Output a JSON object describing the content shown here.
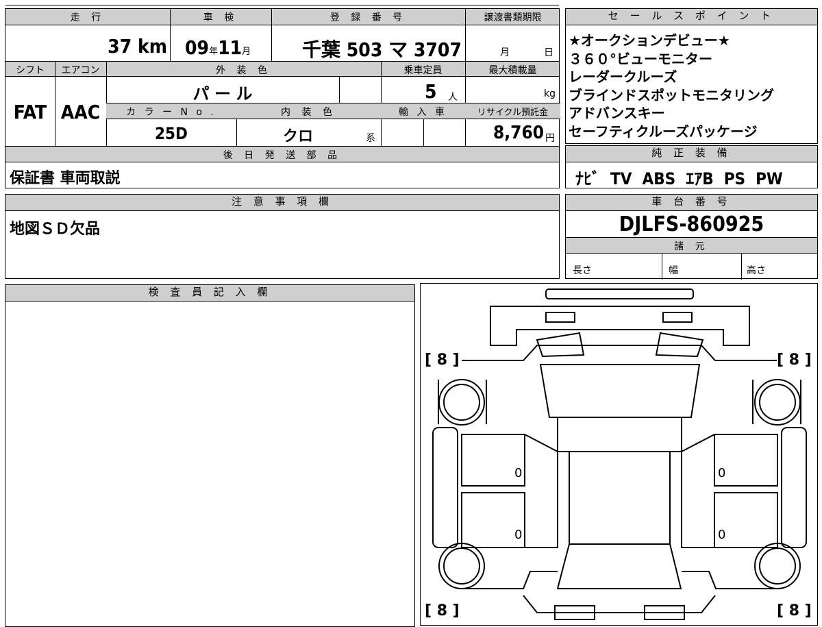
{
  "top": {
    "headers": {
      "mileage": "走 行",
      "inspection": "車 検",
      "registration": "登 録 番 号",
      "transfer_deadline": "譲渡書類期限"
    },
    "mileage_value": "37",
    "mileage_unit": "km",
    "inspection_year": "09",
    "inspection_year_unit": "年",
    "inspection_month": "11",
    "inspection_month_unit": "月",
    "registration_region": "千葉",
    "registration_number": "503 マ 3707",
    "transfer_month": "月",
    "transfer_day": "日"
  },
  "row2": {
    "headers": {
      "shift": "シフト",
      "aircon": "エアコン",
      "exterior_color": "外 装 色",
      "capacity": "乗車定員",
      "max_load": "最大積載量",
      "color_no": "カ ラ ー N o .",
      "interior_color": "内 装 色",
      "import": "輸 入 車",
      "recycle_fee": "リサイクル預託金"
    },
    "shift": "FAT",
    "aircon": "AAC",
    "exterior_color": "パ ー ル",
    "capacity": "5",
    "capacity_unit": "人",
    "max_load_unit": "kg",
    "color_no": "25D",
    "interior_color": "クロ",
    "interior_suffix": "系",
    "recycle_fee": "8,760",
    "recycle_unit": "円"
  },
  "later_parts": {
    "header": "後 日 発 送 部 品",
    "value": "保証書 車両取説"
  },
  "notes": {
    "header": "注 意 事 項 欄",
    "value": "地図ＳＤ欠品"
  },
  "sales_points": {
    "header": "セ ー ル ス ポ イ ン ト",
    "items": [
      "★オークションデビュー★",
      "３６０°ビューモニター",
      "レーダークルーズ",
      "ブラインドスポットモニタリング",
      "アドバンスキー",
      "セーフティクルーズパッケージ"
    ]
  },
  "equipment": {
    "header": "純 正 装 備",
    "value": "ﾅﾋﾞ  TV  ABS  ｴｱB  PS  PW"
  },
  "chassis": {
    "header": "車 台 番 号",
    "value": "DJLFS-860925"
  },
  "specs": {
    "header": "諸 元",
    "length": "長さ",
    "width": "幅",
    "height": "高さ"
  },
  "inspector": {
    "header": "検 査 員 記 入 欄"
  },
  "diagram": {
    "tire_front_left": "[ 8 ]",
    "tire_front_right": "[ 8 ]",
    "tire_rear_left": "[ 8 ]",
    "tire_rear_right": "[ 8 ]",
    "door_fl": "0",
    "door_rl": "0",
    "door_fr": "0",
    "door_rr": "0"
  }
}
